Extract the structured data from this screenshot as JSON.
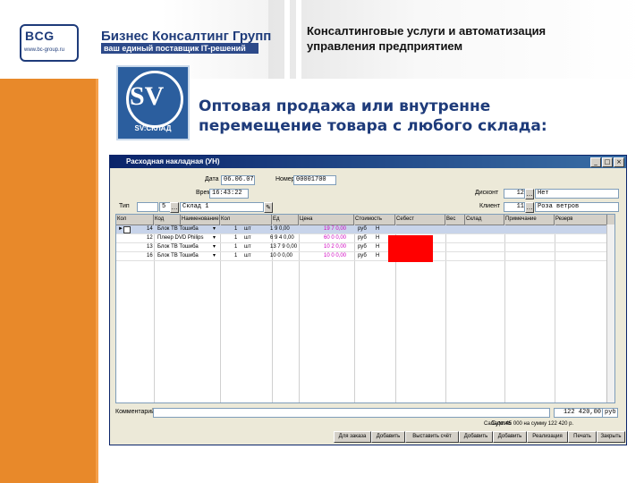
{
  "header": {
    "brand_logo": "BCG",
    "brand_url": "www.bc-group.ru",
    "company_name": "Бизнес Консалтинг Групп",
    "company_tagline": "ваш единый поставщик IT-решений",
    "title_line1": "Консалтинговые услуги и автоматизация",
    "title_line2": "управления предприятием"
  },
  "product_logo": {
    "letters": "SV",
    "caption": "SV:СКЛАД"
  },
  "subtitle": {
    "line1": "Оптовая продажа или внутренне",
    "line2": "перемещение товара с любого склада:"
  },
  "window": {
    "title": "Расходная накладная (УН)",
    "controls": [
      "_",
      "□",
      "×"
    ],
    "fields": {
      "date_label": "Дата",
      "date_value": "06.06.07",
      "number_label": "Номер",
      "number_value": "00001700",
      "time_label": "Время",
      "time_value": "16:43:22",
      "type_label": "Тип",
      "warehouse_label": "Склад 1",
      "warehouse_code": "5",
      "discount_label": "Дисконт",
      "discount_value": "12",
      "discount_name": "Нет",
      "client_label": "Клиент",
      "client_code": "11",
      "client_name": "Роза ветров"
    },
    "columns": [
      "Кол",
      "Код",
      "Наименование",
      "Кол",
      "Ед",
      "Цена",
      "Стоимость",
      "Себест",
      "Вес",
      "Склад",
      "Примечание",
      "Резерв"
    ],
    "rows": [
      {
        "num": "14",
        "name": "Блок ТВ Тошиба",
        "qty": "1",
        "unit": "шт",
        "price": "1 9 0,00",
        "cost": "19 7 0,00",
        "mark": "руб",
        "flag": "Н"
      },
      {
        "num": "12",
        "name": "Плеер DVD Philips",
        "qty": "1",
        "unit": "шт",
        "price": "6 9 4 0,00",
        "cost": "60 0 0,00",
        "mark": "руб",
        "flag": "Н"
      },
      {
        "num": "13",
        "name": "Блок ТВ Тошиба",
        "qty": "1",
        "unit": "шт",
        "price": "13 7 9 0,00",
        "cost": "10 2 0,00",
        "mark": "руб",
        "flag": "Н"
      },
      {
        "num": "16",
        "name": "Блок ТВ Тошиба",
        "qty": "1",
        "unit": "шт",
        "price": "10 0 0,00",
        "cost": "10 0 0,00",
        "mark": "руб",
        "flag": "Н"
      }
    ],
    "footer": {
      "comment_label": "Комментарий",
      "sum_label": "Сумма",
      "sum_value": "122 420,00",
      "sum_currency": "руб",
      "status_text": "Сальдо: 45 000 на сумму 122 420 р."
    },
    "bottom_buttons": [
      "Для заказа",
      "Добавить",
      "Выставить счёт",
      "Добавить",
      "Добавить",
      "Реализация",
      "Печать",
      "Закрыть"
    ]
  }
}
